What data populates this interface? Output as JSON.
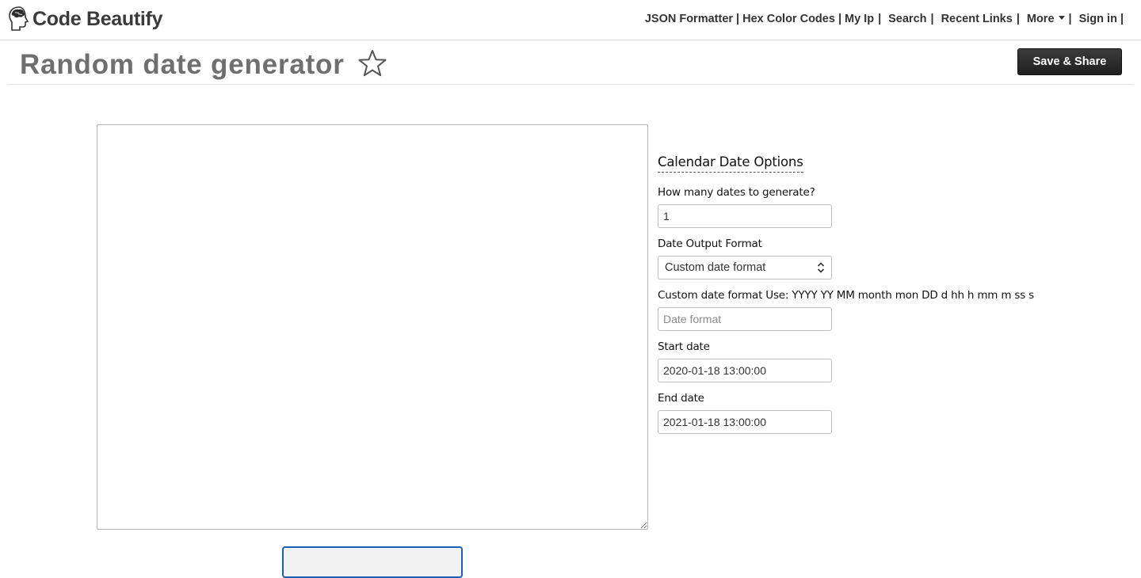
{
  "header": {
    "logo_text": "Code Beautify",
    "logo_icon": "brain-head-icon",
    "nav": [
      {
        "label": "JSON Formatter"
      },
      {
        "label": "Hex Color Codes"
      },
      {
        "label": "My Ip"
      },
      {
        "label": "Search"
      },
      {
        "label": "Recent Links"
      },
      {
        "label": "More"
      },
      {
        "label": "Sign in"
      }
    ]
  },
  "page": {
    "title": "Random date generator",
    "favorite_icon": "star-outline-icon",
    "save_label": "Save & Share"
  },
  "output": {
    "value": ""
  },
  "options": {
    "heading": "Calendar Date Options",
    "count_label": "How many dates to generate?",
    "count_value": "1",
    "format_label": "Date Output Format",
    "format_selected": "Custom date format",
    "custom_label": "Custom date format Use: YYYY YY MM month mon DD d hh h mm m ss s",
    "custom_placeholder": "Date format",
    "start_label": "Start date",
    "start_value": "2020-01-18 13:00:00",
    "end_label": "End date",
    "end_value": "2021-01-18 13:00:00"
  },
  "colors": {
    "accent_button": "#1f1f1f",
    "focus_border": "#1a5fb4",
    "title_gray": "#6f6f6f"
  }
}
